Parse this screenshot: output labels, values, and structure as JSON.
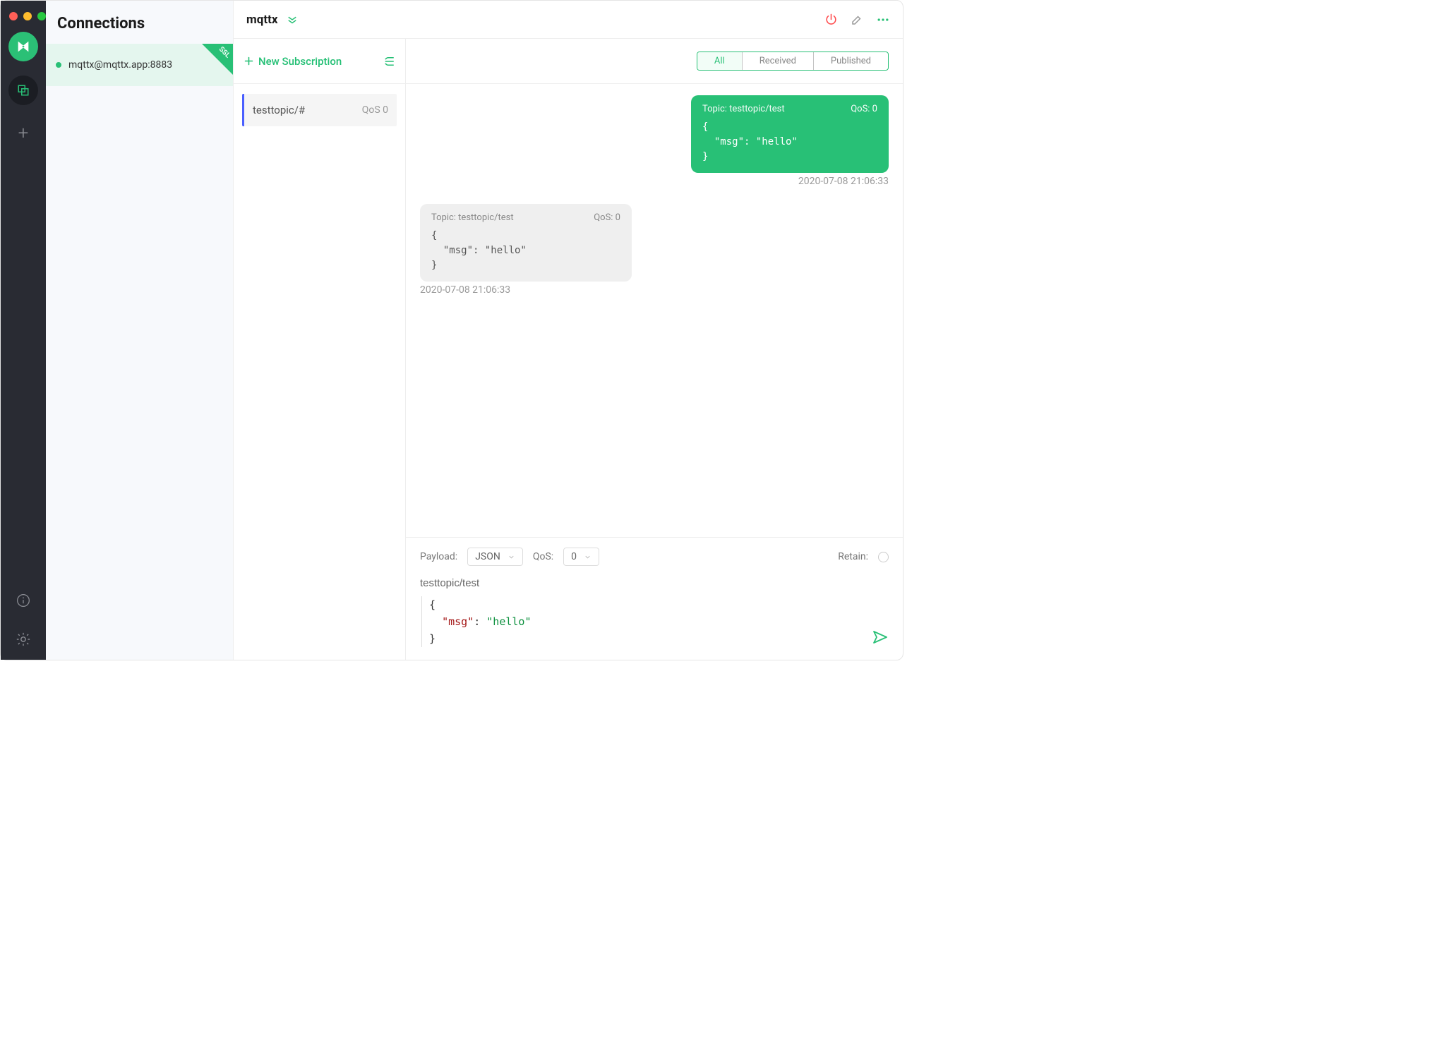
{
  "sidebar": {
    "traffic": true
  },
  "connections": {
    "title": "Connections",
    "items": [
      {
        "name": "mqttx@mqttx.app:8883",
        "ssl": "SSL"
      }
    ]
  },
  "main": {
    "title": "mqttx",
    "filters": {
      "all": "All",
      "received": "Received",
      "published": "Published"
    }
  },
  "subs": {
    "new_label": "New Subscription",
    "items": [
      {
        "topic": "testtopic/#",
        "qos": "QoS 0"
      }
    ]
  },
  "messages": {
    "out": {
      "topic_label": "Topic: testtopic/test",
      "qos_label": "QoS: 0",
      "body": "{\n  \"msg\": \"hello\"\n}",
      "time": "2020-07-08 21:06:33"
    },
    "in": {
      "topic_label": "Topic: testtopic/test",
      "qos_label": "QoS: 0",
      "body": "{\n  \"msg\": \"hello\"\n}",
      "time": "2020-07-08 21:06:33"
    }
  },
  "composer": {
    "payload_label": "Payload:",
    "payload_type": "JSON",
    "qos_label": "QoS:",
    "qos_value": "0",
    "retain_label": "Retain:",
    "topic": "testtopic/test",
    "body_key": "\"msg\"",
    "body_val": "\"hello\""
  }
}
